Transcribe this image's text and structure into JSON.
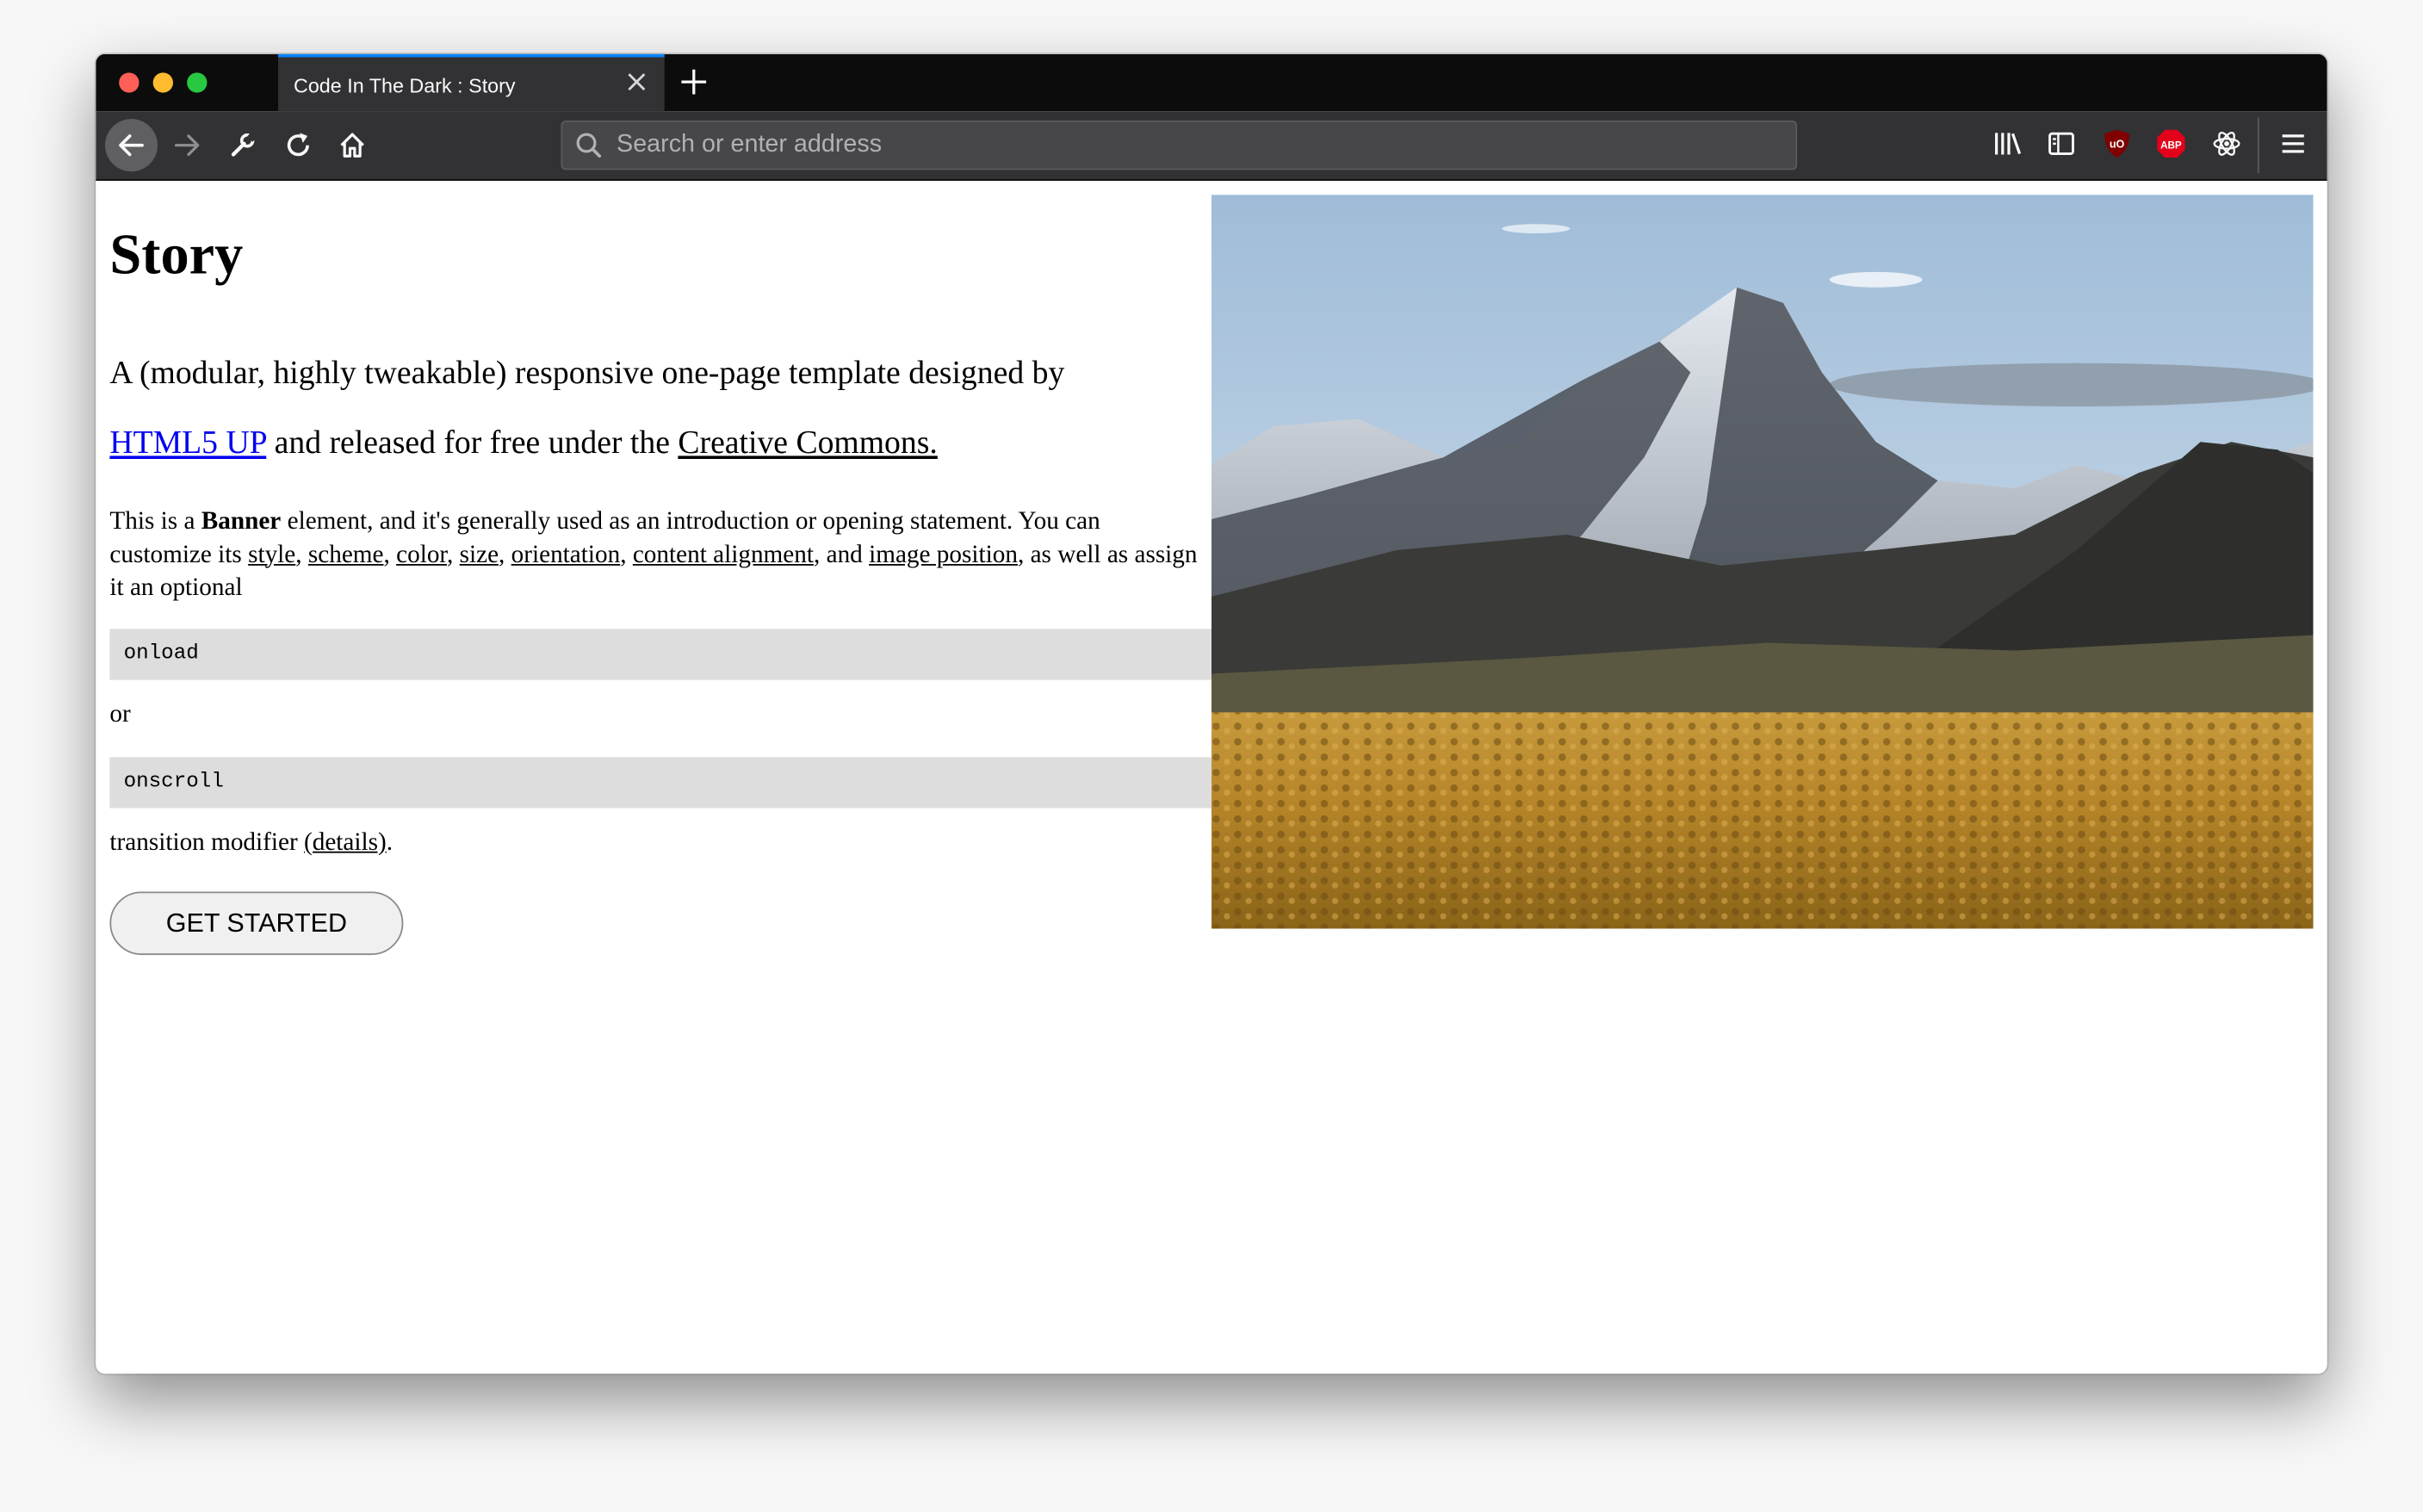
{
  "browser": {
    "tab_title": "Code In The Dark : Story",
    "address_placeholder": "Search or enter address",
    "ublock_badge": "uO",
    "abp_badge": "ABP"
  },
  "page": {
    "heading": "Story",
    "lead": {
      "text_1": "A (modular, highly tweakable) responsive one-page template designed by",
      "link_html5up": "HTML5 UP",
      "text_2": " and released for free under the ",
      "link_cc": "Creative Commons."
    },
    "banner": {
      "t1": "This is a ",
      "bold": "Banner",
      "t2": " element, and it's generally used as an introduction or opening statement. You can customize its ",
      "style": "style",
      "scheme": "scheme",
      "color": "color",
      "size": "size",
      "orientation": "orientation",
      "content_alignment": "content alignment",
      "image_position": "image position",
      "t3": ", as well as assign it an optional"
    },
    "code_1": "onload",
    "or": "or",
    "code_2": "onscroll",
    "transition": {
      "text": "transition modifier ",
      "link": "(details)",
      "end": "."
    },
    "button": "GET STARTED"
  },
  "colors": {
    "tab_accent": "#0a84ff",
    "link": "#0000ee",
    "code_bg": "#dddddd"
  }
}
